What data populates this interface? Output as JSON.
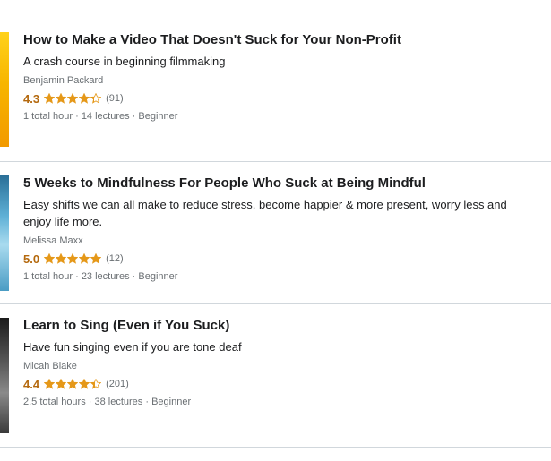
{
  "courses": [
    {
      "title": "How to Make a Video That Doesn't Suck for Your Non-Profit",
      "headline": "A crash course in beginning filmmaking",
      "instructor": "Benjamin Packard",
      "rating": "4.3",
      "stars": 4.3,
      "reviews": "(91)",
      "meta": "1 total hour · 14 lectures · Beginner"
    },
    {
      "title": "5 Weeks to Mindfulness For People Who Suck at Being Mindful",
      "headline": "Easy shifts we can all make to reduce stress, become happier & more present, worry less and enjoy life more.",
      "instructor": "Melissa Maxx",
      "rating": "5.0",
      "stars": 5.0,
      "reviews": "(12)",
      "meta": "1 total hour · 23 lectures · Beginner"
    },
    {
      "title": "Learn to Sing (Even if You Suck)",
      "headline": "Have fun singing even if you are tone deaf",
      "instructor": "Micah Blake",
      "rating": "4.4",
      "stars": 4.4,
      "reviews": "(201)",
      "meta": "2.5 total hours · 38 lectures · Beginner"
    }
  ],
  "colors": {
    "rating": "#b4690e",
    "star": "#e59819",
    "muted": "#6a6f73",
    "divider": "#d1d7dc"
  },
  "icons": {
    "star": "star-icon"
  }
}
